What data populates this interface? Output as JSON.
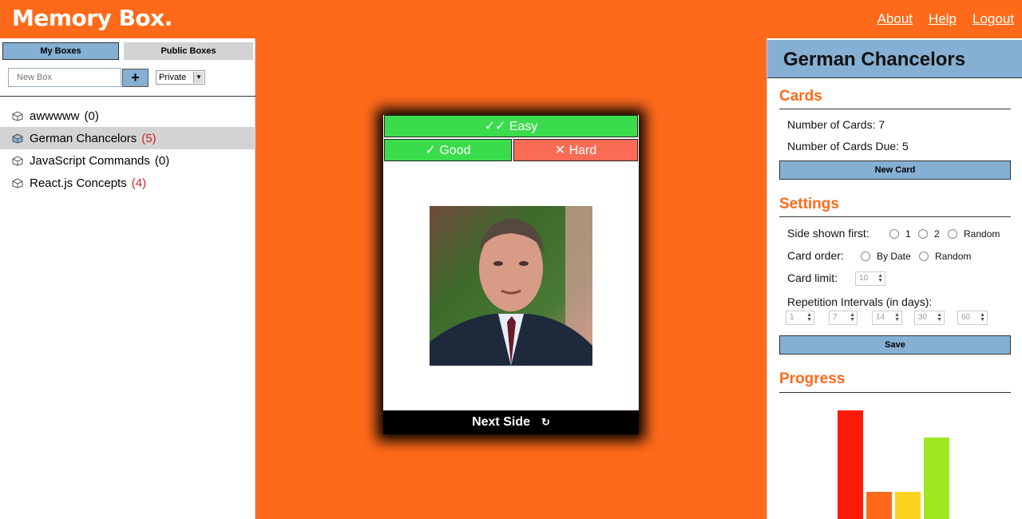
{
  "header": {
    "logo": "Memory Box.",
    "nav": [
      "About",
      "Help",
      "Logout"
    ]
  },
  "sidebar": {
    "tabs": [
      "My Boxes",
      "Public Boxes"
    ],
    "new_box_placeholder": "New Box",
    "add_label": "+",
    "privacy_value": "Private",
    "boxes": [
      {
        "name": "awwwww",
        "count": "(0)",
        "due": false
      },
      {
        "name": "German Chancelors",
        "count": "(5)",
        "due": true
      },
      {
        "name": "JavaScript Commands",
        "count": "(0)",
        "due": false
      },
      {
        "name": "React.js Concepts",
        "count": "(4)",
        "due": true
      }
    ]
  },
  "card": {
    "easy_label": "✓✓ Easy",
    "good_label": "✓ Good",
    "hard_label": "✕ Hard",
    "next_label": "Next Side",
    "next_icon": "↻"
  },
  "panel": {
    "title": "German Chancelors",
    "cards_heading": "Cards",
    "num_cards": "Number of Cards: 7",
    "num_due": "Number of Cards Due: 5",
    "new_card_label": "New Card",
    "settings_heading": "Settings",
    "side_label": "Side shown first:",
    "side_options": [
      "1",
      "2",
      "Random"
    ],
    "order_label": "Card order:",
    "order_options": [
      "By Date",
      "Random"
    ],
    "limit_label": "Card limit:",
    "limit_value": "10",
    "intervals_label": "Repetition Intervals (in days):",
    "intervals": [
      "1",
      "7",
      "14",
      "30",
      "60"
    ],
    "save_label": "Save",
    "progress_heading": "Progress"
  },
  "colors": {
    "brand": "#ff6a1a",
    "accent": "#85afd3",
    "good": "#3bdc4c",
    "hard": "#fb6c56"
  },
  "chart_data": {
    "type": "bar",
    "categories": [
      "",
      "",
      "",
      ""
    ],
    "values": [
      4,
      1,
      1,
      3
    ],
    "colors": [
      "#ff1a0a",
      "#ff6a1a",
      "#fcd21f",
      "#9ee81f"
    ],
    "title": "",
    "xlabel": "",
    "ylabel": "",
    "grid": false
  }
}
